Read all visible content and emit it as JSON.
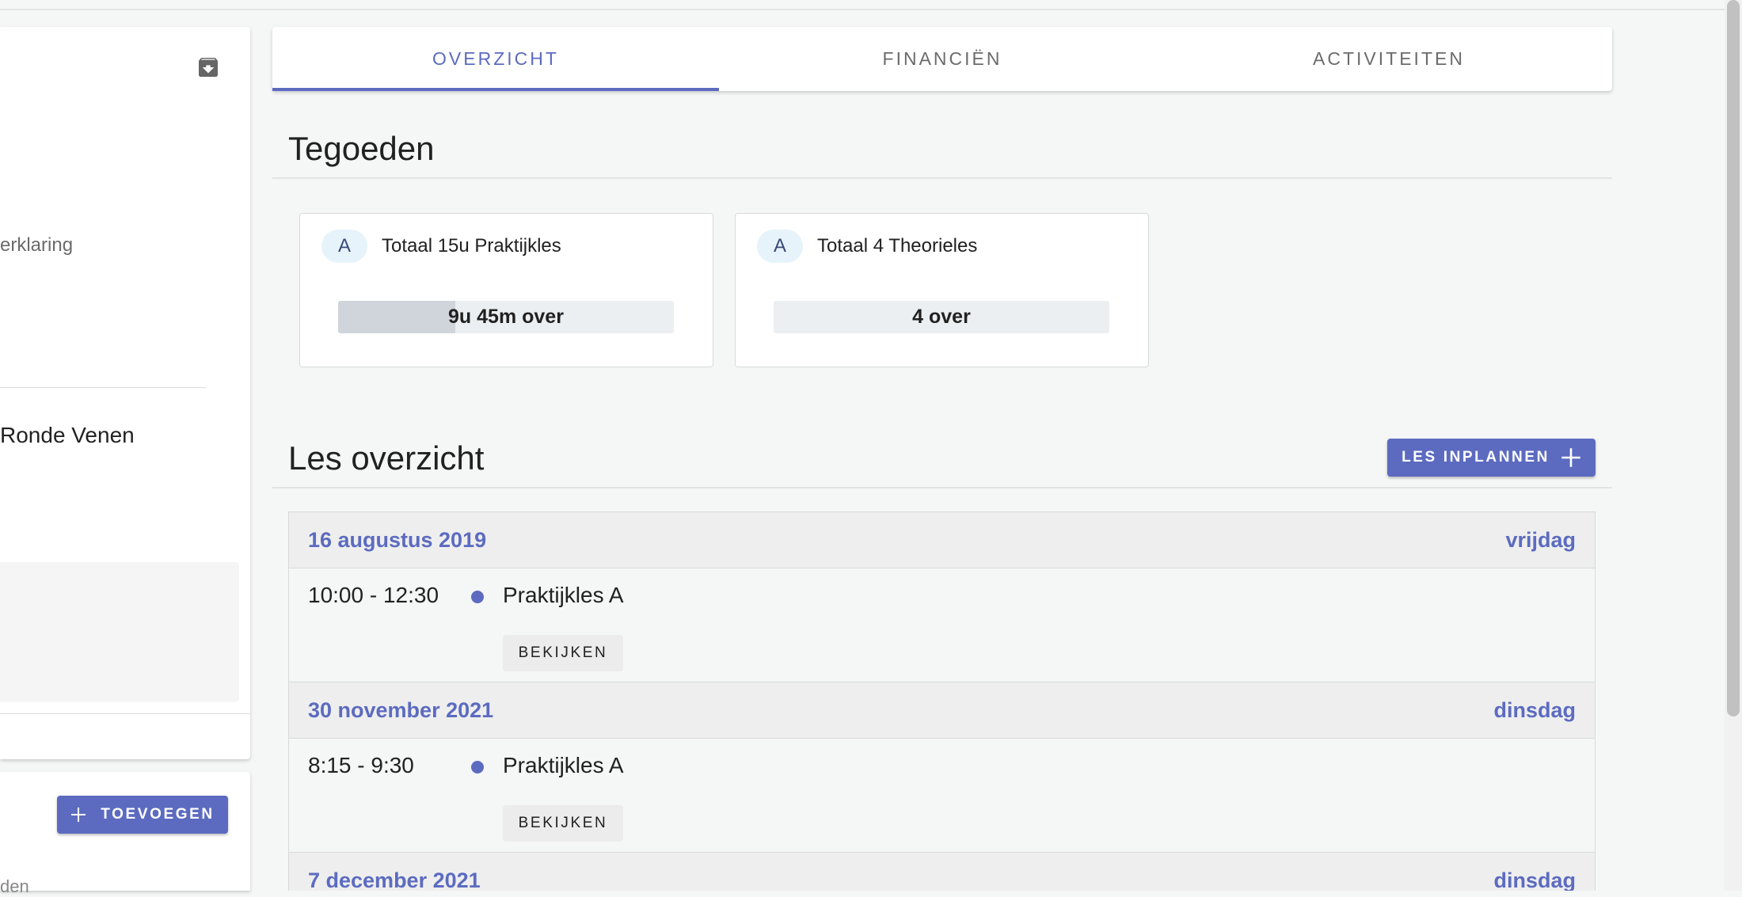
{
  "left_panel": {
    "text1": "erklaring",
    "text2": "Ronde Venen",
    "add_button": "TOEVOEGEN",
    "text3": "den"
  },
  "tabs": [
    {
      "label": "OVERZICHT",
      "active": true
    },
    {
      "label": "FINANCIËN",
      "active": false
    },
    {
      "label": "ACTIVITEITEN",
      "active": false
    }
  ],
  "credits": {
    "title": "Tegoeden",
    "items": [
      {
        "badge": "A",
        "title": "Totaal 15u Praktijkles",
        "remaining": "9u 45m over",
        "fraction": 0.35
      },
      {
        "badge": "A",
        "title": "Totaal 4 Theorieles",
        "remaining": "4 over",
        "fraction": 0.0
      }
    ]
  },
  "lessons": {
    "title": "Les overzicht",
    "plan_button": "LES INPLANNEN",
    "days": [
      {
        "date": "16 augustus 2019",
        "weekday": "vrijdag",
        "time": "10:00 - 12:30",
        "name": "Praktijkles A",
        "button": "BEKIJKEN"
      },
      {
        "date": "30 november 2021",
        "weekday": "dinsdag",
        "time": "8:15 - 9:30",
        "name": "Praktijkles A",
        "button": "BEKIJKEN"
      },
      {
        "date": "7 december 2021",
        "weekday": "dinsdag"
      }
    ]
  },
  "colors": {
    "accent": "#5c6bc0",
    "background": "#f5f6f6"
  }
}
